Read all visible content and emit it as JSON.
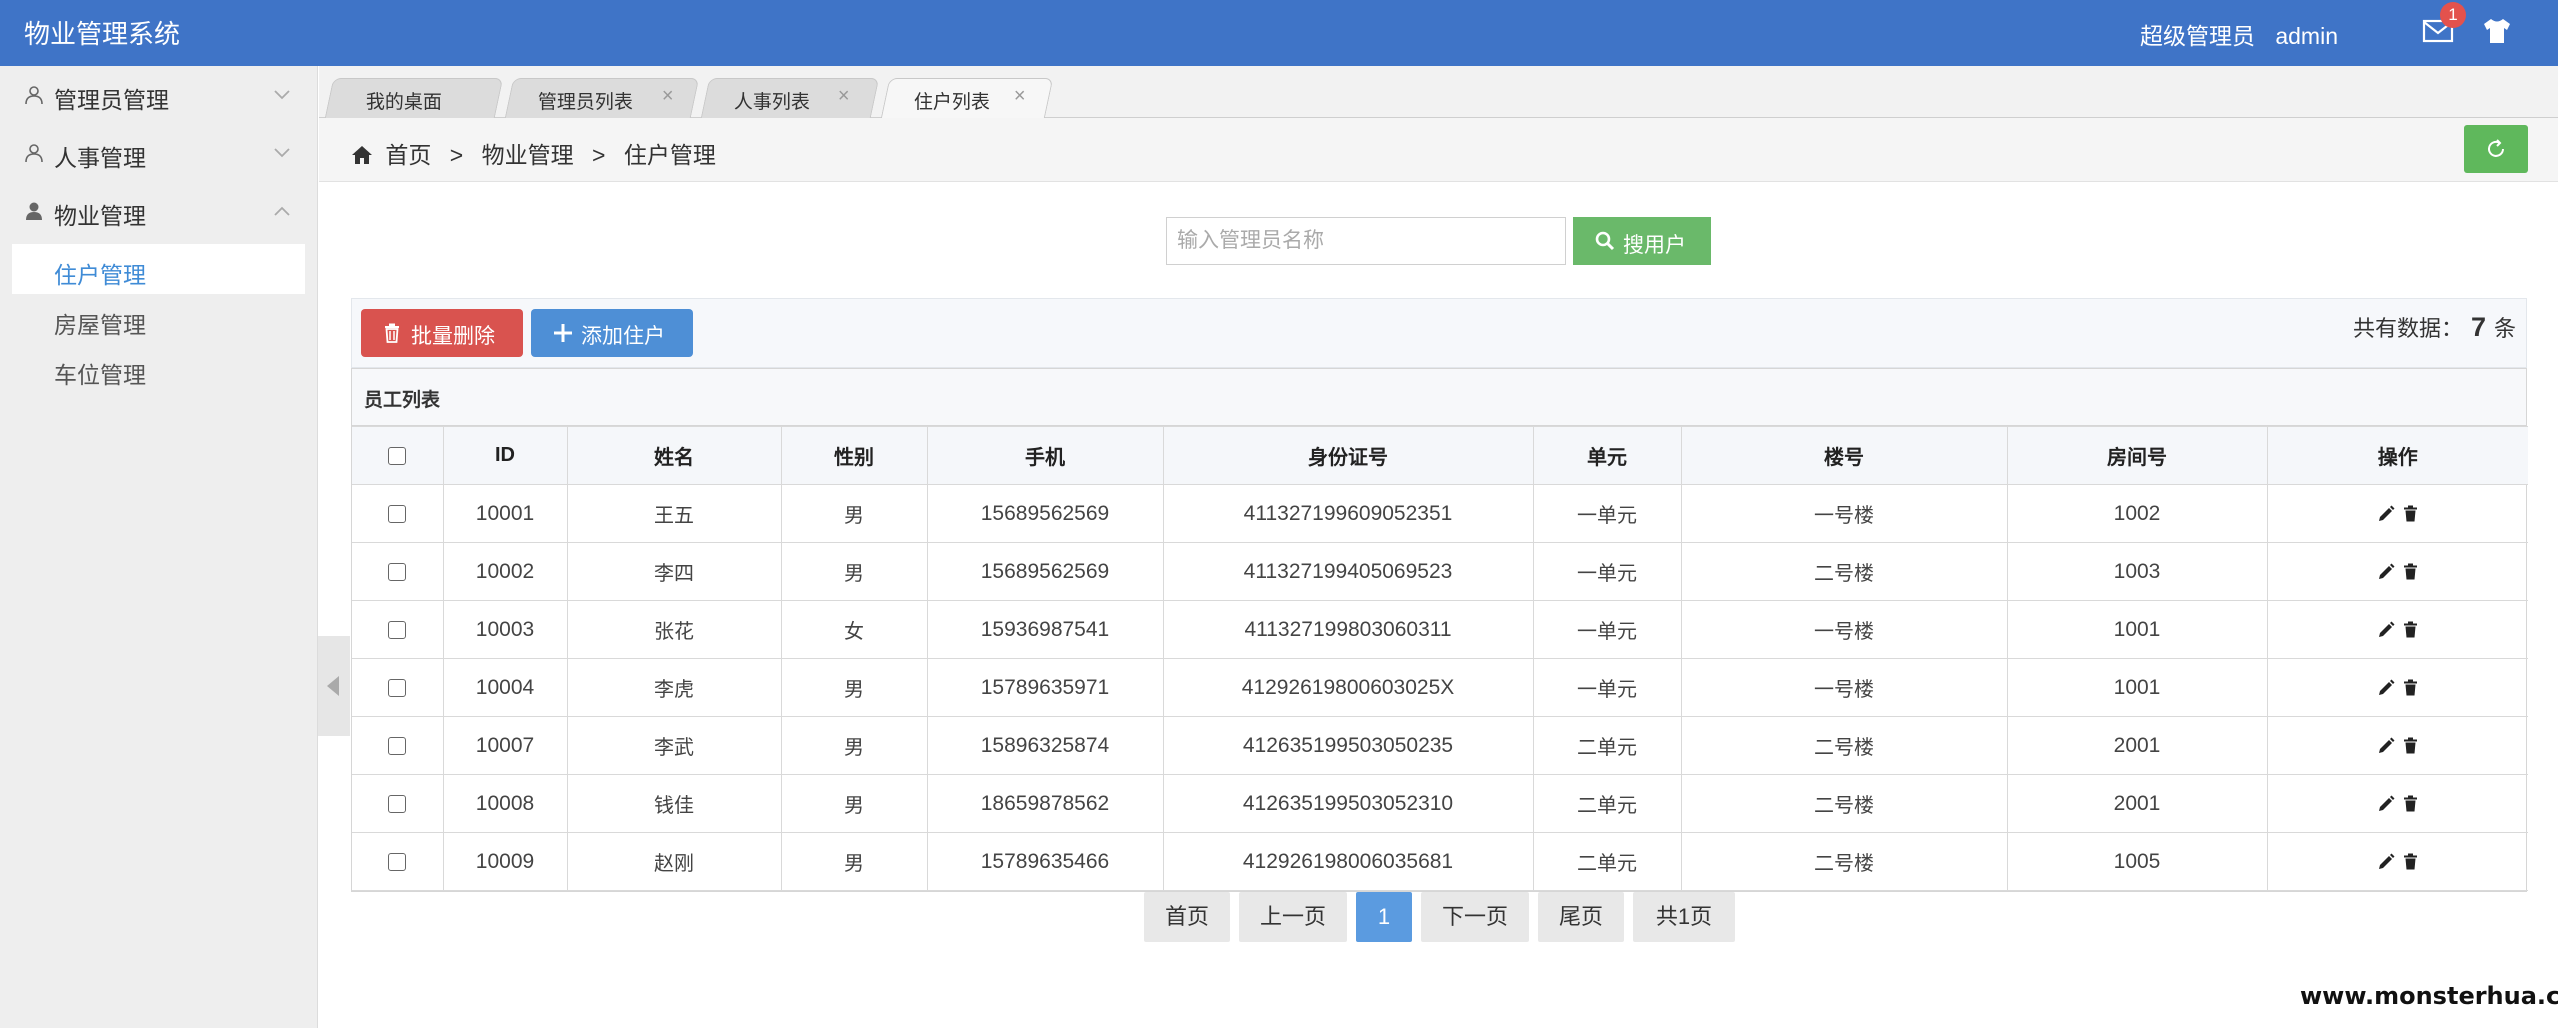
{
  "header": {
    "title": "物业管理系统",
    "role": "超级管理员",
    "username": "admin",
    "mail_badge": "1",
    "brand_color": "#3f74c7"
  },
  "sidebar": {
    "groups": [
      {
        "label": "管理员管理",
        "icon": "user-icon",
        "expanded": false
      },
      {
        "label": "人事管理",
        "icon": "user-icon",
        "expanded": false
      },
      {
        "label": "物业管理",
        "icon": "user-filled-icon",
        "expanded": true
      }
    ],
    "sub_items": [
      {
        "label": "住户管理",
        "active": true
      },
      {
        "label": "房屋管理",
        "active": false
      },
      {
        "label": "车位管理",
        "active": false
      }
    ]
  },
  "tabs": [
    {
      "label": "我的桌面",
      "closable": false
    },
    {
      "label": "管理员列表",
      "closable": true
    },
    {
      "label": "人事列表",
      "closable": true
    },
    {
      "label": "住户列表",
      "closable": true,
      "active": true
    }
  ],
  "breadcrumb": {
    "home": "首页",
    "level1": "物业管理",
    "level2": "住户管理",
    "separator": ">"
  },
  "search": {
    "placeholder": "输入管理员名称",
    "value": "",
    "button_label": "搜用户"
  },
  "toolbar": {
    "batch_delete_label": "批量删除",
    "add_label": "添加住户",
    "count_prefix": "共有数据：",
    "count_value": "7",
    "count_suffix": "条"
  },
  "table": {
    "caption": "员工列表",
    "columns": [
      "ID",
      "姓名",
      "性别",
      "手机",
      "身份证号",
      "单元",
      "楼号",
      "房间号",
      "操作"
    ],
    "rows": [
      {
        "id": "10001",
        "name": "王五",
        "gender": "男",
        "phone": "15689562569",
        "idcard": "411327199609052351",
        "unit": "一单元",
        "building": "一号楼",
        "room": "1002"
      },
      {
        "id": "10002",
        "name": "李四",
        "gender": "男",
        "phone": "15689562569",
        "idcard": "411327199405069523",
        "unit": "一单元",
        "building": "二号楼",
        "room": "1003"
      },
      {
        "id": "10003",
        "name": "张花",
        "gender": "女",
        "phone": "15936987541",
        "idcard": "411327199803060311",
        "unit": "一单元",
        "building": "一号楼",
        "room": "1001"
      },
      {
        "id": "10004",
        "name": "李虎",
        "gender": "男",
        "phone": "15789635971",
        "idcard": "41292619800603025X",
        "unit": "一单元",
        "building": "一号楼",
        "room": "1001"
      },
      {
        "id": "10007",
        "name": "李武",
        "gender": "男",
        "phone": "15896325874",
        "idcard": "412635199503050235",
        "unit": "二单元",
        "building": "二号楼",
        "room": "2001"
      },
      {
        "id": "10008",
        "name": "钱佳",
        "gender": "男",
        "phone": "18659878562",
        "idcard": "412635199503052310",
        "unit": "二单元",
        "building": "二号楼",
        "room": "2001"
      },
      {
        "id": "10009",
        "name": "赵刚",
        "gender": "男",
        "phone": "15789635466",
        "idcard": "412926198006035681",
        "unit": "二单元",
        "building": "二号楼",
        "room": "1005"
      }
    ]
  },
  "pagination": {
    "first": "首页",
    "prev": "上一页",
    "current": "1",
    "next": "下一页",
    "last": "尾页",
    "total": "共1页"
  },
  "watermark": "www.monsterhua.com",
  "colors": {
    "danger": "#d9534f",
    "primary": "#4e8fd6",
    "success": "#5fb85c",
    "active_link": "#3f8bd6"
  }
}
